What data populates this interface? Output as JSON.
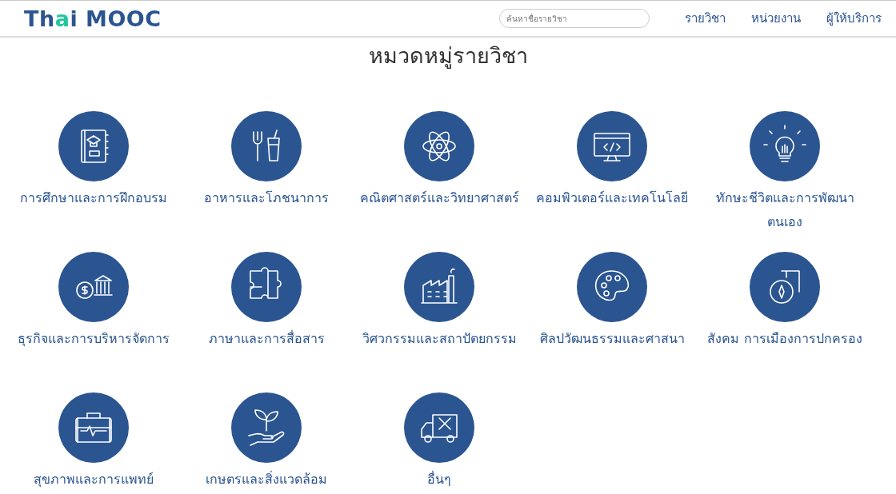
{
  "header": {
    "logo": [
      {
        "text": "Th",
        "kind": "plain"
      },
      {
        "text": "a",
        "kind": "accent"
      },
      {
        "text": "i MOOC",
        "kind": "plain"
      }
    ],
    "search": {
      "placeholder": "ค้นหาชื่อรายวิชา"
    },
    "nav": [
      "รายวิชา",
      "หน่วยงาน",
      "ผู้ให้บริการ"
    ]
  },
  "title": "หมวดหมู่รายวิชา",
  "categories": [
    {
      "label": "การศึกษาและการฝึกอบรม",
      "kind": "book"
    },
    {
      "label": "อาหารและโภชนาการ",
      "kind": "food"
    },
    {
      "label": "คณิตศาสตร์และวิทยาศาสตร์",
      "kind": "atom"
    },
    {
      "label": "คอมพิวเตอร์และเทคโนโลยี",
      "kind": "computer"
    },
    {
      "label": "ทักษะชีวิตและการพัฒนาตนเอง",
      "kind": "bulb"
    },
    {
      "label": "ธุรกิจและการบริหารจัดการ",
      "kind": "bank"
    },
    {
      "label": "ภาษาและการสื่อสาร",
      "kind": "puzzle"
    },
    {
      "label": "วิศวกรรมและสถาปัตยกรรม",
      "kind": "factory"
    },
    {
      "label": "ศิลปวัฒนธรรมและศาสนา",
      "kind": "palette"
    },
    {
      "label": "สังคม การเมืองการปกครอง",
      "kind": "compass"
    },
    {
      "label": "สุขภาพและการแพทย์",
      "kind": "medkit"
    },
    {
      "label": "เกษตรและสิ่งแวดล้อม",
      "kind": "plant"
    },
    {
      "label": "อื่นๆ",
      "kind": "truck"
    }
  ]
}
